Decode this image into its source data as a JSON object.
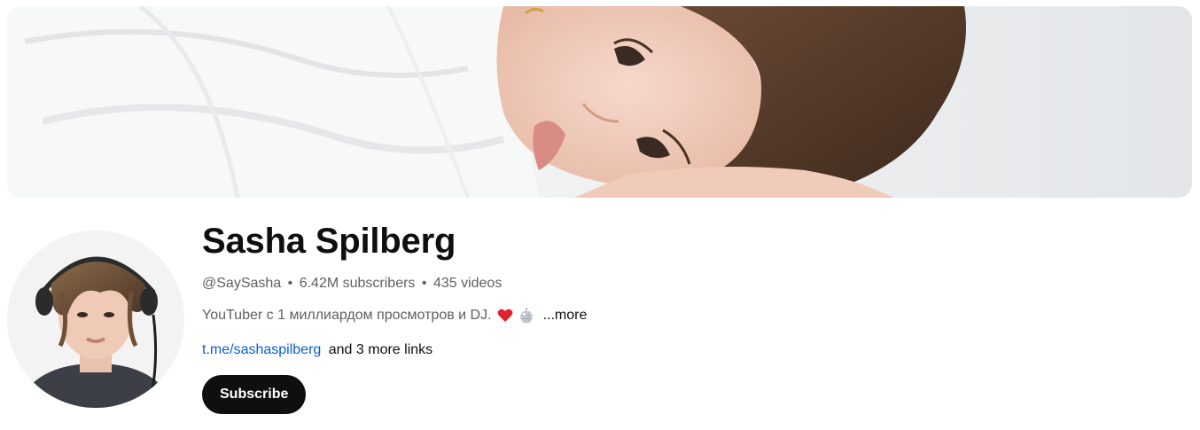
{
  "channel": {
    "name": "Sasha Spilberg",
    "handle": "@SaySasha",
    "separator": "•",
    "subscribers": "6.42M subscribers",
    "videos": "435 videos",
    "description": "YouTuber с 1 миллиардом просмотров и DJ.",
    "description_emojis": [
      "heart-icon",
      "disco-ball-icon"
    ],
    "more_label": "...more",
    "link_text": "t.me/sashaspilberg",
    "more_links": "and 3 more links",
    "subscribe_label": "Subscribe"
  },
  "colors": {
    "text_primary": "#0f0f0f",
    "text_secondary": "#606060",
    "link": "#065fd4",
    "subscribe_bg": "#0f0f0f",
    "heart": "#e0202e"
  }
}
